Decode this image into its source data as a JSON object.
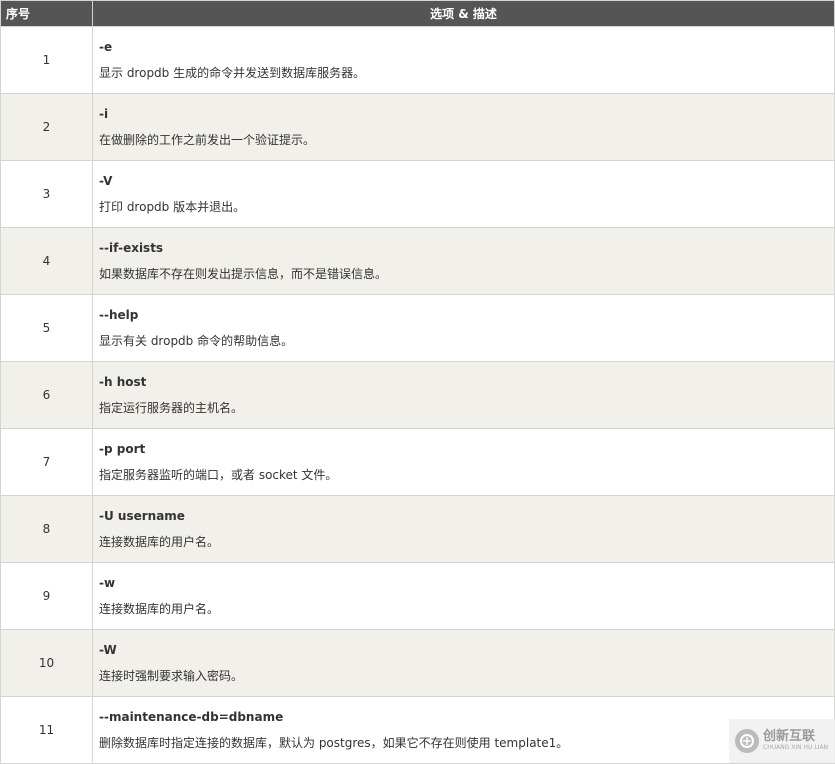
{
  "table": {
    "headers": [
      "序号",
      "选项 & 描述"
    ],
    "rows": [
      {
        "num": "1",
        "option": "-e",
        "desc": "显示 dropdb 生成的命令并发送到数据库服务器。"
      },
      {
        "num": "2",
        "option": "-i",
        "desc": "在做删除的工作之前发出一个验证提示。"
      },
      {
        "num": "3",
        "option": "-V",
        "desc": "打印 dropdb 版本并退出。"
      },
      {
        "num": "4",
        "option": "--if-exists",
        "desc": "如果数据库不存在则发出提示信息，而不是错误信息。"
      },
      {
        "num": "5",
        "option": "--help",
        "desc": "显示有关 dropdb 命令的帮助信息。"
      },
      {
        "num": "6",
        "option": "-h host",
        "desc": "指定运行服务器的主机名。"
      },
      {
        "num": "7",
        "option": "-p port",
        "desc": "指定服务器监听的端口，或者 socket 文件。"
      },
      {
        "num": "8",
        "option": "-U username",
        "desc": "连接数据库的用户名。"
      },
      {
        "num": "9",
        "option": "-w",
        "desc": "连接数据库的用户名。"
      },
      {
        "num": "10",
        "option": "-W",
        "desc": "连接时强制要求输入密码。"
      },
      {
        "num": "11",
        "option": "--maintenance-db=dbname",
        "desc": "删除数据库时指定连接的数据库，默认为 postgres，如果它不存在则使用 template1。"
      }
    ]
  },
  "watermark": {
    "name": "创新互联",
    "sub": "CHUANG XIN HU LIAN",
    "icon": "logo-icon"
  },
  "colors": {
    "header_bg": "#555555",
    "row_alt_bg": "#f1f0ea",
    "border": "#d4d4d4"
  }
}
